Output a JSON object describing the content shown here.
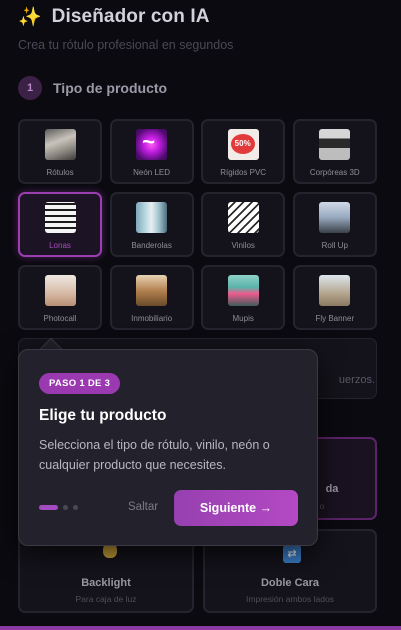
{
  "header": {
    "title": "Diseñador con IA",
    "icon": "sparkles-icon",
    "subtitle": "Crea tu rótulo profesional en segundos"
  },
  "step": {
    "number": "1",
    "label": "Tipo de producto"
  },
  "products": [
    {
      "label": "Rótulos",
      "selected": false
    },
    {
      "label": "Neón LED",
      "selected": false
    },
    {
      "label": "Rígidos PVC",
      "selected": false
    },
    {
      "label": "Corpóreas 3D",
      "selected": false
    },
    {
      "label": "Lonas",
      "selected": true
    },
    {
      "label": "Banderolas",
      "selected": false
    },
    {
      "label": "Vinilos",
      "selected": false
    },
    {
      "label": "Roll Up",
      "selected": false
    },
    {
      "label": "Photocall",
      "selected": false
    },
    {
      "label": "Inmobiliario",
      "selected": false
    },
    {
      "label": "Mupis",
      "selected": false
    },
    {
      "label": "Fly Banner",
      "selected": false
    }
  ],
  "input_hint": "uerzos.",
  "options": {
    "partial_right": {
      "title": "da",
      "subtitle": "o"
    },
    "backlight": {
      "title": "Backlight",
      "subtitle": "Para caja de luz"
    },
    "doble_cara": {
      "title": "Doble Cara",
      "subtitle": "Impresión ambos lados"
    }
  },
  "tour": {
    "badge": "PASO 1 DE 3",
    "title": "Elige tu producto",
    "body": "Selecciona el tipo de rótulo, vinilo, neón o cualquier producto que necesites.",
    "skip": "Saltar",
    "next": "Siguiente →",
    "current_step": 1,
    "total_steps": 3
  },
  "colors": {
    "accent": "#9b3ab0",
    "background": "#0b0a10"
  }
}
